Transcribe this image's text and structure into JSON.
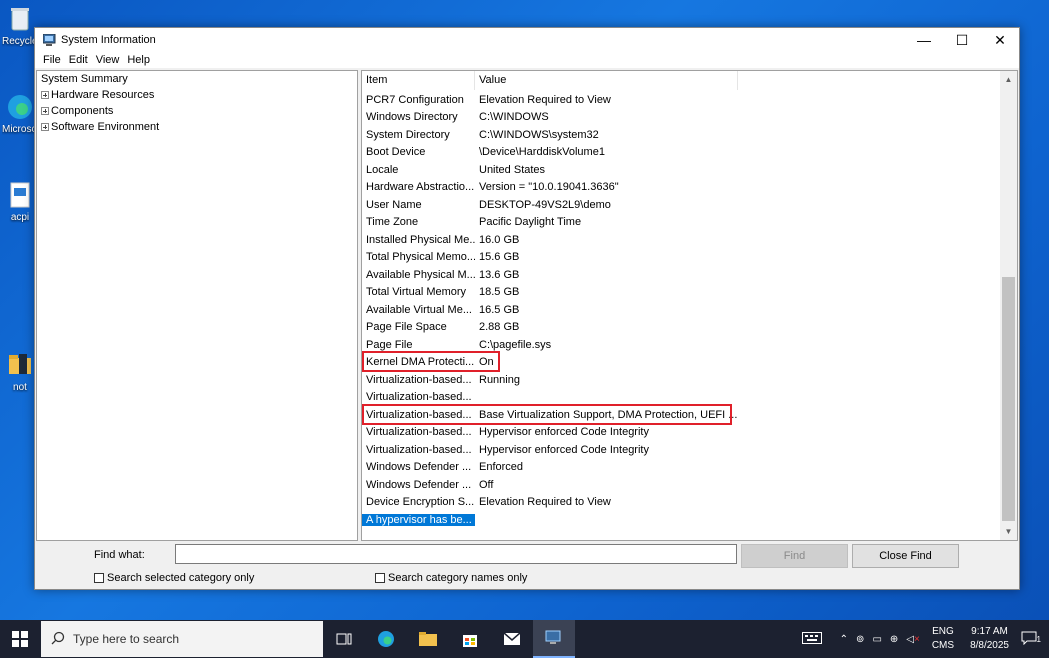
{
  "desktop": {
    "icons": [
      {
        "label": "Recycle Bin"
      },
      {
        "label": "Microsoft Edge"
      },
      {
        "label": "acpi"
      },
      {
        "label": "not"
      }
    ]
  },
  "window": {
    "title": "System Information",
    "controls": {
      "minimize": "—",
      "maximize": "☐",
      "close": "✕"
    },
    "menu": [
      "File",
      "Edit",
      "View",
      "Help"
    ]
  },
  "tree": {
    "items": [
      {
        "label": "System Summary",
        "expandable": false
      },
      {
        "label": "Hardware Resources",
        "expandable": true
      },
      {
        "label": "Components",
        "expandable": true
      },
      {
        "label": "Software Environment",
        "expandable": true
      }
    ]
  },
  "list": {
    "columns": [
      "Item",
      "Value"
    ],
    "rows": [
      {
        "item": "PCR7 Configuration",
        "value": "Elevation Required to View"
      },
      {
        "item": "Windows Directory",
        "value": "C:\\WINDOWS"
      },
      {
        "item": "System Directory",
        "value": "C:\\WINDOWS\\system32"
      },
      {
        "item": "Boot Device",
        "value": "\\Device\\HarddiskVolume1"
      },
      {
        "item": "Locale",
        "value": "United States"
      },
      {
        "item": "Hardware Abstractio...",
        "value": "Version = \"10.0.19041.3636\""
      },
      {
        "item": "User Name",
        "value": "DESKTOP-49VS2L9\\demo"
      },
      {
        "item": "Time Zone",
        "value": "Pacific Daylight Time"
      },
      {
        "item": "Installed Physical Me...",
        "value": "16.0 GB"
      },
      {
        "item": "Total Physical Memo...",
        "value": "15.6 GB"
      },
      {
        "item": "Available Physical M...",
        "value": "13.6 GB"
      },
      {
        "item": "Total Virtual Memory",
        "value": "18.5 GB"
      },
      {
        "item": "Available Virtual Me...",
        "value": "16.5 GB"
      },
      {
        "item": "Page File Space",
        "value": "2.88 GB"
      },
      {
        "item": "Page File",
        "value": "C:\\pagefile.sys"
      },
      {
        "item": "Kernel DMA Protecti...",
        "value": "On"
      },
      {
        "item": "Virtualization-based...",
        "value": "Running"
      },
      {
        "item": "Virtualization-based...",
        "value": ""
      },
      {
        "item": "Virtualization-based...",
        "value": "Base Virtualization Support, DMA Protection, UEFI ..."
      },
      {
        "item": "Virtualization-based...",
        "value": "Hypervisor enforced Code Integrity"
      },
      {
        "item": "Virtualization-based...",
        "value": "Hypervisor enforced Code Integrity"
      },
      {
        "item": "Windows Defender ...",
        "value": "Enforced"
      },
      {
        "item": "Windows Defender ...",
        "value": "Off"
      },
      {
        "item": "Device Encryption S...",
        "value": "Elevation Required to View"
      },
      {
        "item": "A hypervisor has be...",
        "value": ""
      }
    ]
  },
  "find": {
    "label": "Find what:",
    "value": "",
    "find_button": "Find",
    "close_button": "Close Find",
    "check_selected": "Search selected category only",
    "check_names": "Search category names only"
  },
  "taskbar": {
    "search_placeholder": "Type here to search",
    "lang_top": "ENG",
    "lang_bottom": "CMS",
    "time": "9:17 AM",
    "date": "8/8/2025",
    "notification_count": "1"
  },
  "colors": {
    "selection": "#0078d7",
    "highlight_box": "#e0202a",
    "taskbar": "#1c2130"
  }
}
